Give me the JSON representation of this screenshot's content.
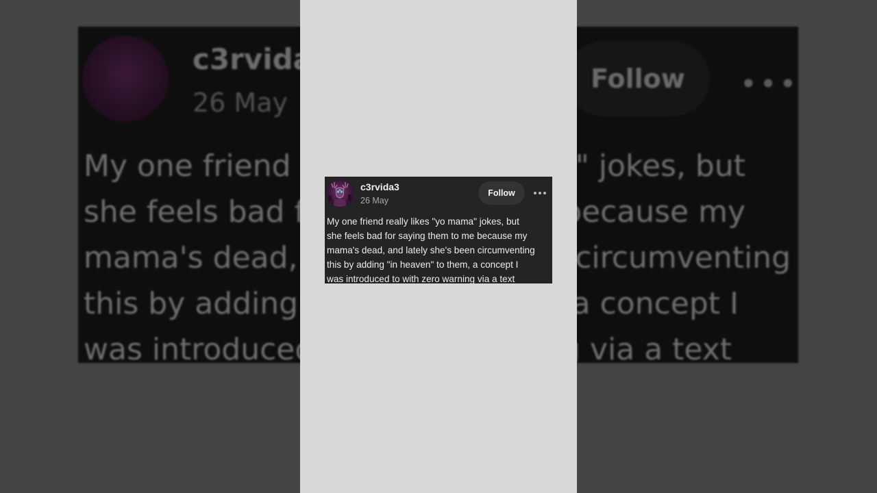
{
  "post": {
    "username": "c3rvida3",
    "date": "26 May",
    "follow_label": "Follow",
    "more_label": "More options",
    "body_lines": [
      "My one friend really likes \"yo mama\" jokes, but",
      "she feels bad for saying them to me because my",
      "mama's dead, and lately she's been circumventing",
      "this by adding \"in heaven\" to them, a concept I",
      "was introduced to with zero warning via a text"
    ]
  },
  "background_copy": {
    "username_fragment": "c3rvida",
    "date_fragment": "26 May",
    "follow_label": "Follow",
    "line_fragments": [
      [
        "My one friend r",
        "a\" jokes, but"
      ],
      [
        "she feels bad fo",
        "e because my"
      ],
      [
        "mama's dead, a",
        "n circumventing"
      ],
      [
        "this by adding \"",
        "a concept I"
      ],
      [
        "was introduced",
        "g via a text"
      ]
    ]
  },
  "colors": {
    "card_background": "#242424",
    "follow_button": "#333333",
    "side_background": "#444444",
    "center_column": "#d8d8d8"
  },
  "icons": {
    "avatar": "deer-avatar-icon",
    "more": "ellipsis-icon"
  }
}
